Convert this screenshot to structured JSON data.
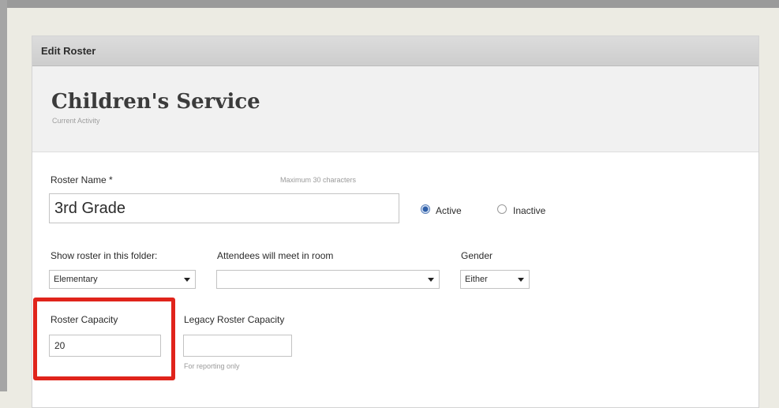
{
  "panel": {
    "header_title": "Edit Roster"
  },
  "activity": {
    "title": "Children's Service",
    "subtitle": "Current Activity"
  },
  "form": {
    "roster_name": {
      "label": "Roster Name *",
      "hint": "Maximum 30 characters",
      "value": "3rd Grade"
    },
    "status": {
      "active_label": "Active",
      "inactive_label": "Inactive",
      "selected": "Active"
    },
    "folder": {
      "label": "Show roster in this folder:",
      "value": "Elementary"
    },
    "room": {
      "label": "Attendees will meet in room",
      "value": ""
    },
    "gender": {
      "label": "Gender",
      "value": "Either"
    },
    "capacity": {
      "label": "Roster Capacity",
      "value": "20"
    },
    "legacy_capacity": {
      "label": "Legacy Roster Capacity",
      "value": "",
      "hint": "For reporting only"
    }
  },
  "colors": {
    "highlight": "#e0241b",
    "page_bg": "#ecebe3",
    "radio_selected": "#2f5fa8"
  }
}
